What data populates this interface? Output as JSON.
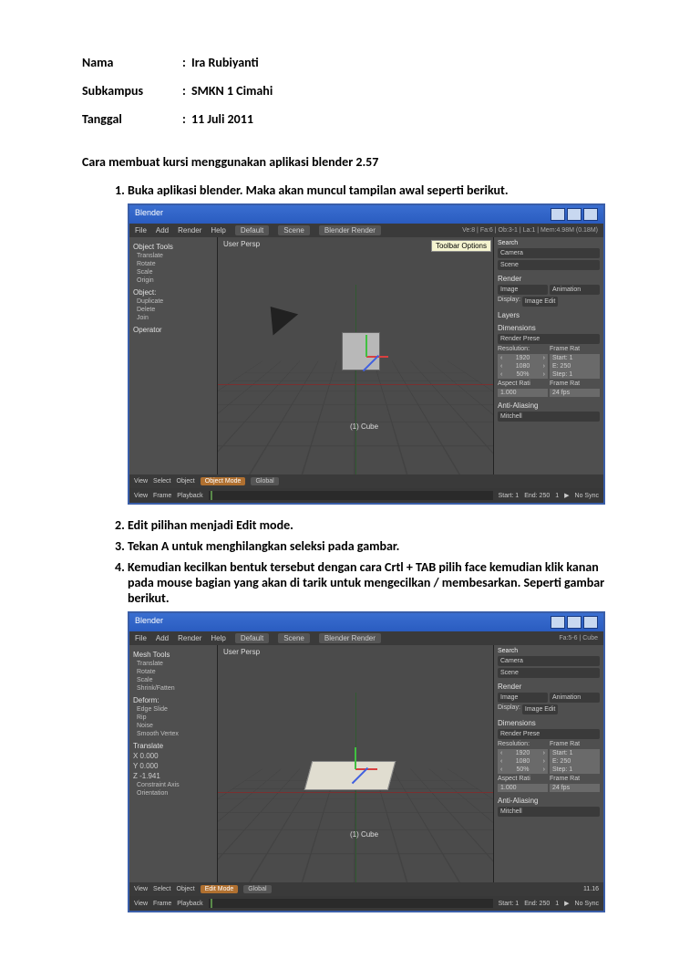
{
  "meta": {
    "name_label": "Nama",
    "name_value": "Ira Rubiyanti",
    "sub_label": "Subkampus",
    "sub_value": "SMKN 1 Cimahi",
    "date_label": "Tanggal",
    "date_value": "11 Juli 2011"
  },
  "title": "Cara membuat kursi menggunakan aplikasi blender 2.57",
  "steps": {
    "s1": "Buka aplikasi blender. Maka akan muncul tampilan awal seperti berikut.",
    "s2": "Edit pilihan menjadi Edit mode.",
    "s3": "Tekan A untuk menghilangkan seleksi pada gambar.",
    "s4": "Kemudian kecilkan bentuk tersebut dengan cara Crtl + TAB pilih face kemudian klik kanan pada mouse bagian yang akan di tarik untuk mengecilkan / membesarkan. Seperti gambar berikut."
  },
  "blender": {
    "window_title": "Blender",
    "menu": {
      "file": "File",
      "add": "Add",
      "render": "Render",
      "help": "Help",
      "layout": "Default",
      "scene": "Scene",
      "engine": "Blender Render"
    },
    "stats1": "Ve:8 | Fa:6 | Ob:3-1 | La:1 | Mem:4.98M (0.18M)",
    "stats2": "Fa:5-6 | Cube",
    "left1": {
      "header": "Object Tools",
      "items": [
        "Translate",
        "Rotate",
        "Scale",
        "Origin"
      ],
      "header2": "Object:",
      "items2": [
        "Duplicate",
        "Delete",
        "Join"
      ],
      "header3": "Operator"
    },
    "left2": {
      "header": "Mesh Tools",
      "items": [
        "Translate",
        "Rotate",
        "Scale",
        "Shrink/Fatten"
      ],
      "header2": "Deform:",
      "items2": [
        "Edge Slide",
        "Rip",
        "Noise",
        "Smooth Vertex"
      ],
      "header3": "Translate",
      "coords": [
        "X 0.000",
        "Y 0.000",
        "Z -1.941"
      ],
      "caxis": "Constraint Axis",
      "orient": "Orientation"
    },
    "viewport": {
      "label": "User Persp",
      "obj": "(1) Cube"
    },
    "right": {
      "search": "Search",
      "scene": "Scene",
      "render": "Render",
      "image_btn": "Image",
      "anim_btn": "Animation",
      "display": "Display:",
      "display_val": "Image Edit",
      "layers": "Layers",
      "dimensions": "Dimensions",
      "preset": "Render Prese",
      "resolution": "Resolution:",
      "framerate": "Frame Rat",
      "res_x": "1920",
      "res_y": "1080",
      "res_pct": "50%",
      "start": "Start: 1",
      "end": "E: 250",
      "step": "Step: 1",
      "aspect": "Aspect Rati",
      "fr": "Frame Rat",
      "ax": "1.000",
      "ay": "1.000",
      "fps": "24 fps",
      "aa": "Anti-Aliasing",
      "mitchell": "Mitchell",
      "tooltip": "Toolbar Options",
      "camera": "Camera"
    },
    "footer1": {
      "view": "View",
      "select": "Select",
      "object": "Object",
      "mode1": "Object Mode",
      "mode2": "Edit Mode",
      "global": "Global"
    },
    "footer_mem1": "(1) Cube",
    "timeline": {
      "view": "View",
      "frame": "Frame",
      "playback": "Playback",
      "start": "Start: 1",
      "end": "End: 250",
      "cur": "1",
      "nosync": "No Sync",
      "mem": "11.16"
    }
  }
}
